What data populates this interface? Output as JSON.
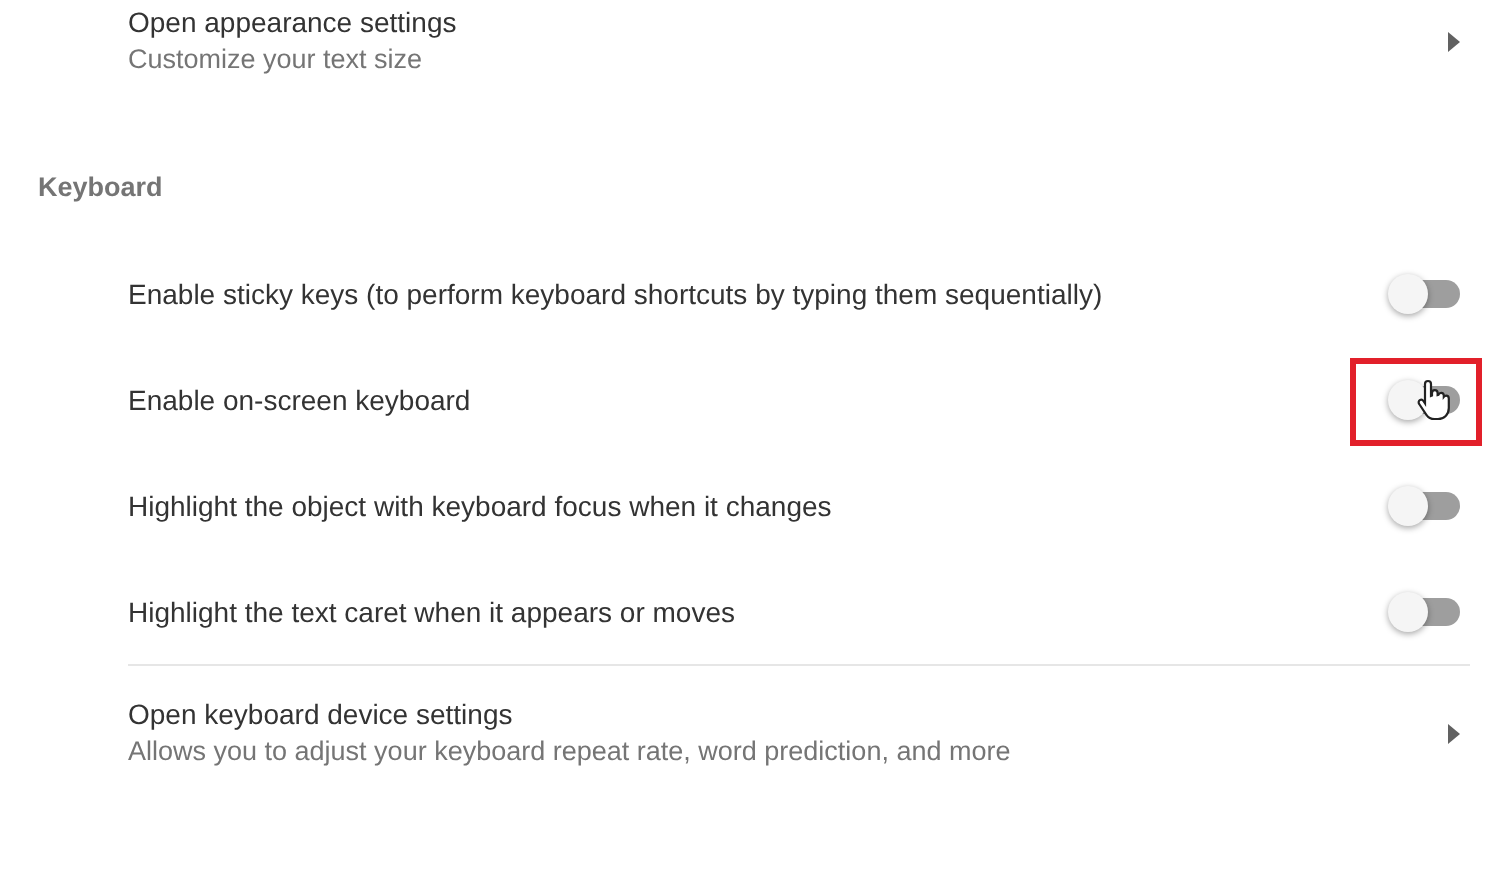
{
  "appearance_link": {
    "title": "Open appearance settings",
    "subtitle": "Customize your text size"
  },
  "section": {
    "heading": "Keyboard",
    "toggles": [
      {
        "label": "Enable sticky keys (to perform keyboard shortcuts by typing them sequentially)",
        "on": false,
        "highlighted": false
      },
      {
        "label": "Enable on-screen keyboard",
        "on": false,
        "highlighted": true
      },
      {
        "label": "Highlight the object with keyboard focus when it changes",
        "on": false,
        "highlighted": false
      },
      {
        "label": "Highlight the text caret when it appears or moves",
        "on": false,
        "highlighted": false
      }
    ],
    "device_link": {
      "title": "Open keyboard device settings",
      "subtitle": "Allows you to adjust your keyboard repeat rate, word prediction, and more"
    }
  }
}
